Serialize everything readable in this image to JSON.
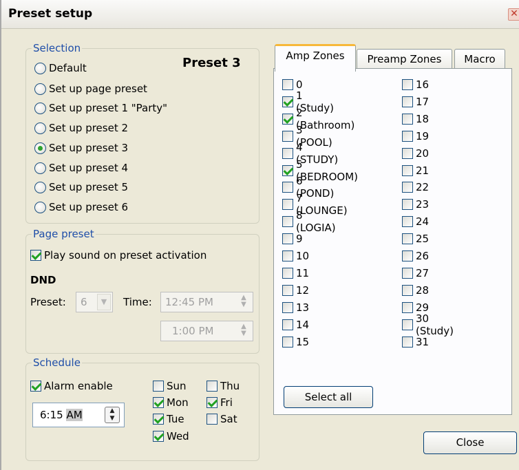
{
  "window": {
    "title": "Preset setup",
    "close_glyph": "✕"
  },
  "selection": {
    "legend": "Selection",
    "current_preset_label": "Preset 3",
    "options": [
      {
        "label": "Default",
        "checked": false
      },
      {
        "label": "Set up page preset",
        "checked": false
      },
      {
        "label": "Set up preset 1 \"Party\"",
        "checked": false
      },
      {
        "label": "Set up preset 2",
        "checked": false
      },
      {
        "label": "Set up preset 3",
        "checked": true
      },
      {
        "label": "Set up preset 4",
        "checked": false
      },
      {
        "label": "Set up preset 5",
        "checked": false
      },
      {
        "label": "Set up preset 6",
        "checked": false
      }
    ]
  },
  "page_preset": {
    "legend": "Page preset",
    "play_sound_label": "Play sound on preset activation",
    "play_sound_checked": true,
    "dnd_label": "DND",
    "preset_label": "Preset:",
    "preset_value": "6",
    "time_label": "Time:",
    "time_start": "12:45 PM",
    "time_end": "1:00 PM"
  },
  "schedule": {
    "legend": "Schedule",
    "alarm_enable_label": "Alarm enable",
    "alarm_enable_checked": true,
    "time_value": "6:15",
    "time_ampm": "AM",
    "days": [
      {
        "label": "Sun",
        "checked": false
      },
      {
        "label": "Mon",
        "checked": true
      },
      {
        "label": "Tue",
        "checked": true
      },
      {
        "label": "Wed",
        "checked": true
      },
      {
        "label": "Thu",
        "checked": false
      },
      {
        "label": "Fri",
        "checked": true
      },
      {
        "label": "Sat",
        "checked": false
      }
    ]
  },
  "tabs": [
    {
      "label": "Amp Zones",
      "active": true
    },
    {
      "label": "Preamp Zones",
      "active": false
    },
    {
      "label": "Macro",
      "active": false
    }
  ],
  "zones": [
    {
      "label": "0",
      "checked": false
    },
    {
      "label": "1 (Study)",
      "checked": true
    },
    {
      "label": "2 (Bathroom)",
      "checked": true
    },
    {
      "label": "3 (POOL)",
      "checked": false
    },
    {
      "label": "4 (STUDY)",
      "checked": false
    },
    {
      "label": "5 (BEDROOM)",
      "checked": true
    },
    {
      "label": "6 (POND)",
      "checked": false
    },
    {
      "label": "7 (LOUNGE)",
      "checked": false
    },
    {
      "label": "8 (LOGIA)",
      "checked": false
    },
    {
      "label": "9",
      "checked": false
    },
    {
      "label": "10",
      "checked": false
    },
    {
      "label": "11",
      "checked": false
    },
    {
      "label": "12",
      "checked": false
    },
    {
      "label": "13",
      "checked": false
    },
    {
      "label": "14",
      "checked": false
    },
    {
      "label": "15",
      "checked": false
    },
    {
      "label": "16",
      "checked": false
    },
    {
      "label": "17",
      "checked": false
    },
    {
      "label": "18",
      "checked": false
    },
    {
      "label": "19",
      "checked": false
    },
    {
      "label": "20",
      "checked": false
    },
    {
      "label": "21",
      "checked": false
    },
    {
      "label": "22",
      "checked": false
    },
    {
      "label": "23",
      "checked": false
    },
    {
      "label": "24",
      "checked": false
    },
    {
      "label": "25",
      "checked": false
    },
    {
      "label": "26",
      "checked": false
    },
    {
      "label": "27",
      "checked": false
    },
    {
      "label": "28",
      "checked": false
    },
    {
      "label": "29",
      "checked": false
    },
    {
      "label": "30 (Study)",
      "checked": false
    },
    {
      "label": "31",
      "checked": false
    }
  ],
  "buttons": {
    "select_all": "Select all",
    "close": "Close"
  }
}
